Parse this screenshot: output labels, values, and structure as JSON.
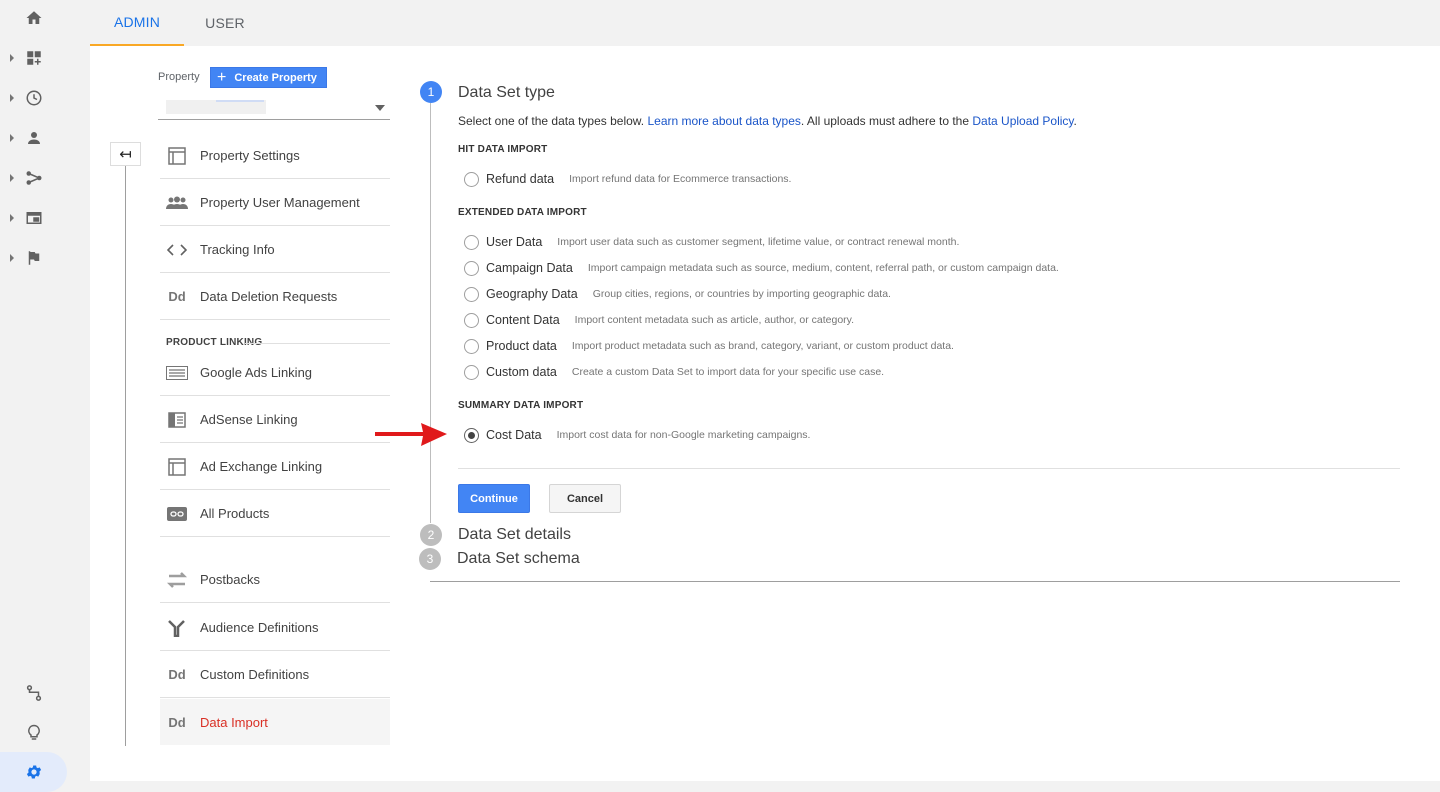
{
  "tabs": {
    "admin": "ADMIN",
    "user": "USER"
  },
  "property": {
    "label": "Property",
    "create_button": "Create Property",
    "create_icon": "+"
  },
  "back_icon": "↤",
  "menu": {
    "items": [
      {
        "label": "Property Settings",
        "icon": "layout-icon"
      },
      {
        "label": "Property User Management",
        "icon": "people-icon"
      },
      {
        "label": "Tracking Info",
        "icon": "code-icon"
      },
      {
        "label": "Data Deletion Requests",
        "icon": "dd-icon"
      }
    ],
    "product_linking_label": "PRODUCT LINKING",
    "linking_items": [
      {
        "label": "Google Ads Linking",
        "icon": "ads-icon"
      },
      {
        "label": "AdSense Linking",
        "icon": "adsense-icon"
      },
      {
        "label": "Ad Exchange Linking",
        "icon": "adexchange-icon"
      },
      {
        "label": "All Products",
        "icon": "link-icon"
      }
    ],
    "other_items": [
      {
        "label": "Postbacks",
        "icon": "postbacks-icon"
      },
      {
        "label": "Audience Definitions",
        "icon": "audience-icon"
      },
      {
        "label": "Custom Definitions",
        "icon": "dd-icon"
      },
      {
        "label": "Data Import",
        "icon": "dd-icon",
        "active": true
      }
    ],
    "dd_glyph": "Dd"
  },
  "wizard": {
    "steps": [
      {
        "number": "1",
        "title": "Data Set type"
      },
      {
        "number": "2",
        "title": "Data Set details"
      },
      {
        "number": "3",
        "title": "Data Set schema"
      }
    ],
    "description": {
      "prefix": "Select one of the data types below. ",
      "link1": "Learn more about data types",
      "middle": ". All uploads must adhere to the ",
      "link2": "Data Upload Policy",
      "suffix": "."
    },
    "groups": {
      "hit": "HIT DATA IMPORT",
      "extended": "EXTENDED DATA IMPORT",
      "summary": "SUMMARY DATA IMPORT"
    },
    "options": {
      "refund": {
        "label": "Refund data",
        "desc": "Import refund data for Ecommerce transactions."
      },
      "user": {
        "label": "User Data",
        "desc": "Import user data such as customer segment, lifetime value, or contract renewal month."
      },
      "campaign": {
        "label": "Campaign Data",
        "desc": "Import campaign metadata such as source, medium, content, referral path, or custom campaign data."
      },
      "geography": {
        "label": "Geography Data",
        "desc": "Group cities, regions, or countries by importing geographic data."
      },
      "content": {
        "label": "Content Data",
        "desc": "Import content metadata such as article, author, or category."
      },
      "product": {
        "label": "Product data",
        "desc": "Import product metadata such as brand, category, variant, or custom product data."
      },
      "custom": {
        "label": "Custom data",
        "desc": "Create a custom Data Set to import data for your specific use case."
      },
      "cost": {
        "label": "Cost Data",
        "desc": "Import cost data for non-Google marketing campaigns.",
        "selected": true
      }
    },
    "buttons": {
      "continue": "Continue",
      "cancel": "Cancel"
    }
  },
  "colors": {
    "accent": "#4285f4",
    "active_text": "#d93025",
    "tab_underline": "#f9a825",
    "annotation_arrow": "#e0191b"
  }
}
